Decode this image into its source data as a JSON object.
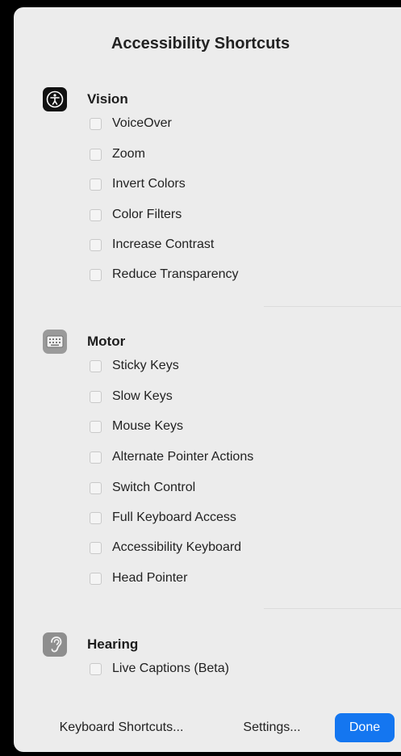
{
  "title": "Accessibility Shortcuts",
  "sections": {
    "vision": {
      "label": "Vision",
      "icon": "accessibility-person-icon",
      "options": [
        "VoiceOver",
        "Zoom",
        "Invert Colors",
        "Color Filters",
        "Increase Contrast",
        "Reduce Transparency"
      ]
    },
    "motor": {
      "label": "Motor",
      "icon": "keyboard-icon",
      "options": [
        "Sticky Keys",
        "Slow Keys",
        "Mouse Keys",
        "Alternate Pointer Actions",
        "Switch Control",
        "Full Keyboard Access",
        "Accessibility Keyboard",
        "Head Pointer"
      ]
    },
    "hearing": {
      "label": "Hearing",
      "icon": "ear-icon",
      "options": [
        "Live Captions (Beta)"
      ]
    }
  },
  "buttons": {
    "keyboard_shortcuts": "Keyboard Shortcuts...",
    "settings": "Settings...",
    "done": "Done"
  },
  "colors": {
    "accent": "#1476f0",
    "panel_background": "#ececec"
  }
}
